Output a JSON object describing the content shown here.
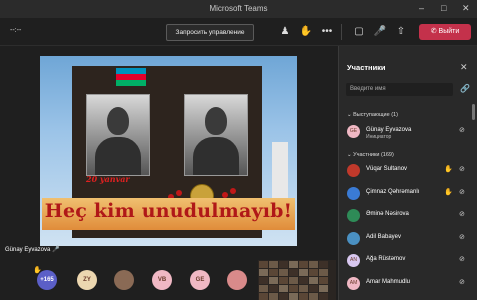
{
  "window": {
    "title": "Microsoft Teams"
  },
  "toolbar": {
    "timer": "--:--",
    "request_control": "Запросить управление",
    "leave": "Выйти"
  },
  "stage": {
    "speaker_label": "Günay Eyvazova",
    "video": {
      "banner": "Heç kim unudulmayıb!",
      "date": "20 yanvar"
    },
    "avatars": [
      {
        "type": "count",
        "text": "+165",
        "color": "#5b5fc7"
      },
      {
        "type": "initials",
        "text": "ZY",
        "color": "#ecd7b0"
      },
      {
        "type": "photo",
        "text": "",
        "color": "#8a6a55"
      },
      {
        "type": "initials",
        "text": "VB",
        "color": "#f0b8c4"
      },
      {
        "type": "initials",
        "text": "GE",
        "color": "#f0b8c4"
      },
      {
        "type": "photo",
        "text": "",
        "color": "#d98a8a"
      }
    ]
  },
  "panel": {
    "title": "Участники",
    "search_placeholder": "Введите имя",
    "presenters_section": "Выступающие (1)",
    "participants_section": "Участники (169)",
    "presenters": [
      {
        "initials": "GE",
        "name": "Günay Eyvazova",
        "role": "Инициатор",
        "hand": false,
        "color": "#f0b8c4"
      }
    ],
    "participants": [
      {
        "initials": "",
        "name": "Vüqar Sultanov",
        "hand": true,
        "color": "#c0392b"
      },
      {
        "initials": "",
        "name": "Çimnaz Qəhrəmanlı",
        "hand": true,
        "color": "#3a7bd5"
      },
      {
        "initials": "",
        "name": "Əminə Nəsirova",
        "hand": false,
        "color": "#2e8b57"
      },
      {
        "initials": "",
        "name": "Adil Babayev",
        "hand": false,
        "color": "#4a90c2"
      },
      {
        "initials": "AN",
        "name": "Ağa Rüstəmov",
        "hand": false,
        "color": "#d8c7f0"
      },
      {
        "initials": "AM",
        "name": "Amar Mahmudlu",
        "hand": false,
        "color": "#f0b8c4"
      }
    ]
  }
}
